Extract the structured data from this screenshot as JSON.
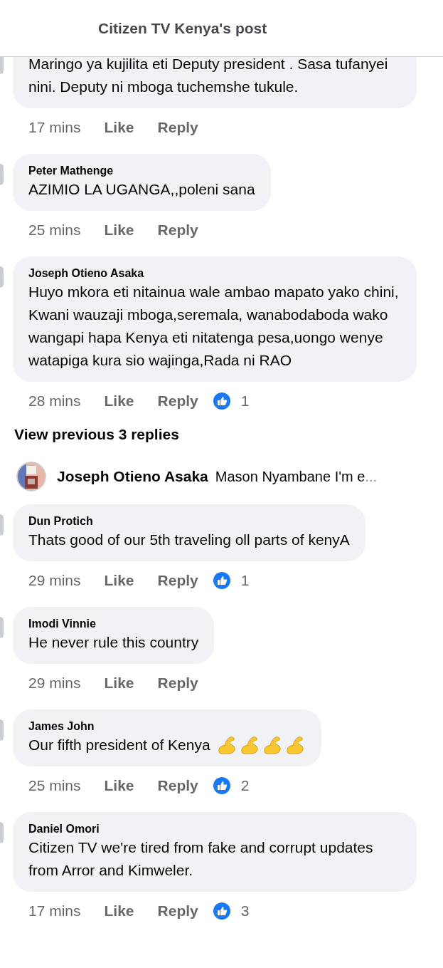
{
  "header": {
    "title": "Citizen TV Kenya's post"
  },
  "comments": [
    {
      "text": "Maringo ya kujilita eti Deputy president . Sasa tufanyei nini. Deputy ni mboga tuchemshe tukule.",
      "time": "17 mins",
      "like": "Like",
      "reply": "Reply"
    },
    {
      "author": "Peter Mathenge",
      "text": "AZIMIO LA UGANGA,,poleni sana",
      "time": "25 mins",
      "like": "Like",
      "reply": "Reply"
    },
    {
      "author": "Joseph Otieno Asaka",
      "text": "Huyo mkora eti nitainua wale ambao mapato yako chini, Kwani wauzaji mboga,seremala, wanabodaboda wako wangapi hapa Kenya eti nitatenga pesa,uongo wenye watapiga kura sio wajinga,Rada ni RAO",
      "time": "28 mins",
      "like": "Like",
      "reply": "Reply",
      "reactions": "1"
    }
  ],
  "thread": {
    "view_previous": "View previous 3 replies",
    "reply_preview": {
      "author": "Joseph Otieno Asaka",
      "text": "Mason Nyambane I'm e",
      "ellipsis": "..."
    }
  },
  "more_comments": [
    {
      "author": "Dun Protich",
      "text": "Thats good of our 5th traveling  oll parts of kenyA",
      "time": "29 mins",
      "like": "Like",
      "reply": "Reply",
      "reactions": "1"
    },
    {
      "author": "Imodi Vinnie",
      "text": "He never rule this country",
      "time": "29 mins",
      "like": "Like",
      "reply": "Reply"
    },
    {
      "author": "James John",
      "text": "Our fifth president of Kenya",
      "emojis": [
        {
          "kind": "flexed-biceps"
        },
        {
          "kind": "flexed-biceps"
        },
        {
          "kind": "flexed-biceps"
        },
        {
          "kind": "flexed-biceps"
        }
      ],
      "time": "25 mins",
      "like": "Like",
      "reply": "Reply",
      "reactions": "2"
    },
    {
      "author": "Daniel Omori",
      "text": "Citizen TV we're tired from fake and corrupt updates from Arror and Kimweler.",
      "time": "17 mins",
      "like": "Like",
      "reply": "Reply",
      "reactions": "3"
    }
  ]
}
